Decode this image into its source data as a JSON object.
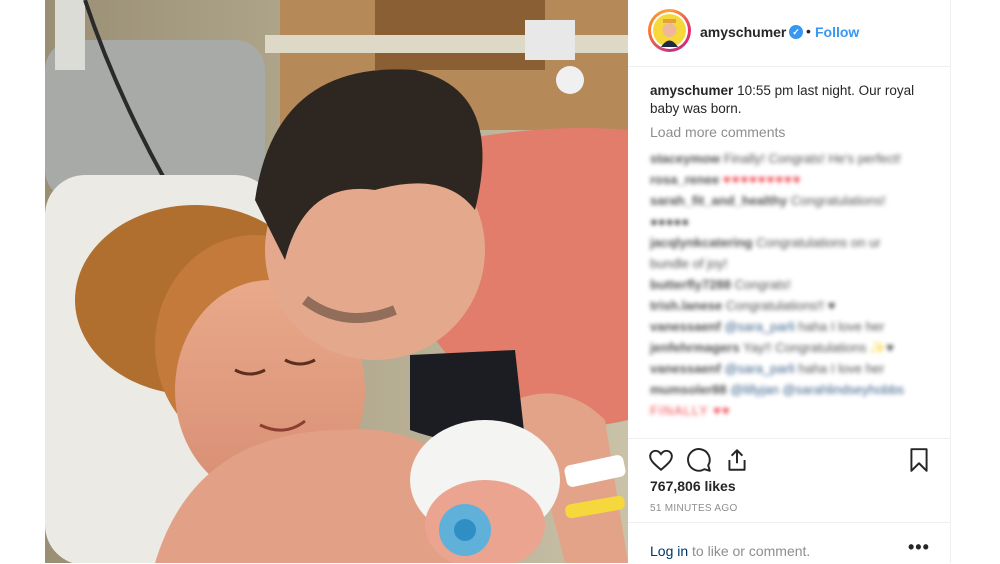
{
  "post": {
    "username": "amyschumer",
    "verified_mark": "✓",
    "separator": "•",
    "follow_label": "Follow",
    "caption_user": "amyschumer",
    "caption_text": "10:55 pm last night. Our royal baby was born.",
    "load_more_label": "Load more comments",
    "likes": "767,806 likes",
    "timestamp": "51 MINUTES AGO",
    "login_link": "Log in",
    "login_suffix": "to like or comment.",
    "more_label": "•••"
  },
  "comments": [
    {
      "user": "staceymow",
      "text": "Finally! Congrats! He's perfect!"
    },
    {
      "user": "rosa_renee",
      "text": "♥♥♥♥♥♥♥♥♥",
      "hearts": true
    },
    {
      "user": "sarah_fit_and_healthy",
      "text": "Congratulations!"
    },
    {
      "user": "",
      "text": "●●●●●"
    },
    {
      "user": "jacqlynkcatering",
      "text": "Congratulations on ur"
    },
    {
      "user": "",
      "text": "bundle of joy!"
    },
    {
      "user": "butterfly7288",
      "text": "Congrats!"
    },
    {
      "user": "trish.lanese",
      "text": "Congratulations!! ♥"
    },
    {
      "user": "vanessaenf",
      "text": "haha I love her",
      "mention": "@sara_parli"
    },
    {
      "user": "jenfehrmagers",
      "text": "Yay!! Congratulations ✨♥"
    },
    {
      "user": "vanessaenf",
      "text": "haha I love her",
      "mention": "@sara_parli"
    },
    {
      "user": "mumsoler88",
      "text": "@sarahlindseyhobbs",
      "mention": "@lillyjan"
    },
    {
      "user": "",
      "text": "FINALLY ♥♥"
    }
  ],
  "icons": {
    "like": "heart-icon",
    "comment": "comment-icon",
    "share": "share-icon",
    "save": "bookmark-icon"
  },
  "colors": {
    "accent": "#3897f0",
    "text": "#262626",
    "muted": "#8e8e8e",
    "link": "#003569"
  }
}
